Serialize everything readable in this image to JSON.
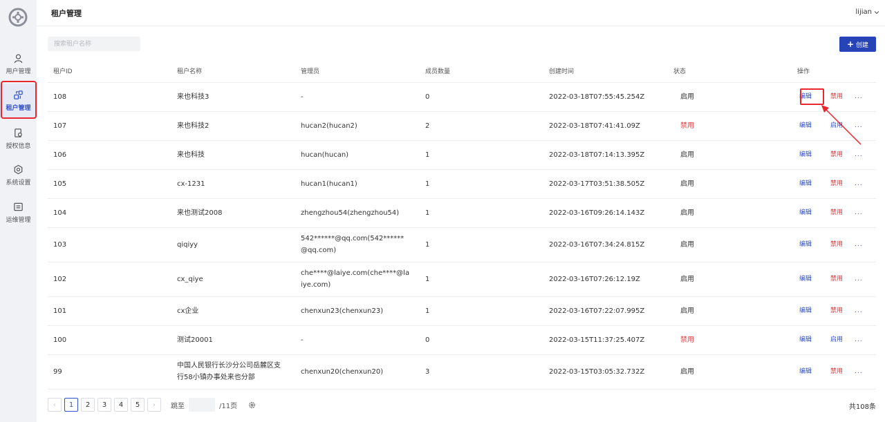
{
  "sidebar": {
    "items": [
      {
        "label": "用户管理",
        "icon": "user-icon"
      },
      {
        "label": "租户管理",
        "icon": "tenant-icon"
      },
      {
        "label": "授权信息",
        "icon": "license-icon"
      },
      {
        "label": "系统设置",
        "icon": "settings-icon"
      },
      {
        "label": "运维管理",
        "icon": "ops-icon"
      }
    ],
    "active": "租户管理"
  },
  "header": {
    "title": "租户管理",
    "user": "lijian"
  },
  "toolbar": {
    "search_placeholder": "搜索租户名称",
    "create_label": "创建"
  },
  "table": {
    "columns": [
      "租户ID",
      "租户名称",
      "管理员",
      "成员数量",
      "创建时间",
      "状态",
      "操作"
    ],
    "rows": [
      {
        "id": "108",
        "name": "来也科技3",
        "admin": "-",
        "members": "0",
        "created": "2022-03-18T07:55:45.254Z",
        "status": "启用",
        "toggle": "禁用"
      },
      {
        "id": "107",
        "name": "来也科技2",
        "admin": "hucan2(hucan2)",
        "members": "2",
        "created": "2022-03-18T07:41:41.09Z",
        "status": "禁用",
        "toggle": "启用"
      },
      {
        "id": "106",
        "name": "来也科技",
        "admin": "hucan(hucan)",
        "members": "1",
        "created": "2022-03-18T07:14:13.395Z",
        "status": "启用",
        "toggle": "禁用"
      },
      {
        "id": "105",
        "name": "cx-1231",
        "admin": "hucan1(hucan1)",
        "members": "1",
        "created": "2022-03-17T03:51:38.505Z",
        "status": "启用",
        "toggle": "禁用"
      },
      {
        "id": "104",
        "name": "来也测试2008",
        "admin": "zhengzhou54(zhengzhou54)",
        "members": "1",
        "created": "2022-03-16T09:26:14.143Z",
        "status": "启用",
        "toggle": "禁用"
      },
      {
        "id": "103",
        "name": "qiqiyy",
        "admin": "542******@qq.com(542******@qq.com)",
        "members": "1",
        "created": "2022-03-16T07:34:24.815Z",
        "status": "启用",
        "toggle": "禁用"
      },
      {
        "id": "102",
        "name": "cx_qiye",
        "admin": "che****@laiye.com(che****@laiye.com)",
        "members": "1",
        "created": "2022-03-16T07:26:12.19Z",
        "status": "启用",
        "toggle": "禁用"
      },
      {
        "id": "101",
        "name": "cx企业",
        "admin": "chenxun23(chenxun23)",
        "members": "1",
        "created": "2022-03-16T07:22:07.995Z",
        "status": "启用",
        "toggle": "禁用"
      },
      {
        "id": "100",
        "name": "测试20001",
        "admin": "-",
        "members": "0",
        "created": "2022-03-15T11:37:25.407Z",
        "status": "禁用",
        "toggle": "启用"
      },
      {
        "id": "99",
        "name": "中国人民银行长沙分公司岳麓区支行58小镇办事处来也分部",
        "admin": "chenxun20(chenxun20)",
        "members": "3",
        "created": "2022-03-15T03:05:32.732Z",
        "status": "启用",
        "toggle": "禁用"
      }
    ],
    "edit_label": "编辑",
    "more_label": "..."
  },
  "pagination": {
    "prev": "‹",
    "next": "›",
    "pages": [
      "1",
      "2",
      "3",
      "4",
      "5"
    ],
    "current": "1",
    "jump_label": "跳至",
    "page_total": "/11页",
    "total": "共108条"
  },
  "colors": {
    "primary": "#2743b8",
    "danger": "#e5383b",
    "highlight": "#e8262b"
  }
}
